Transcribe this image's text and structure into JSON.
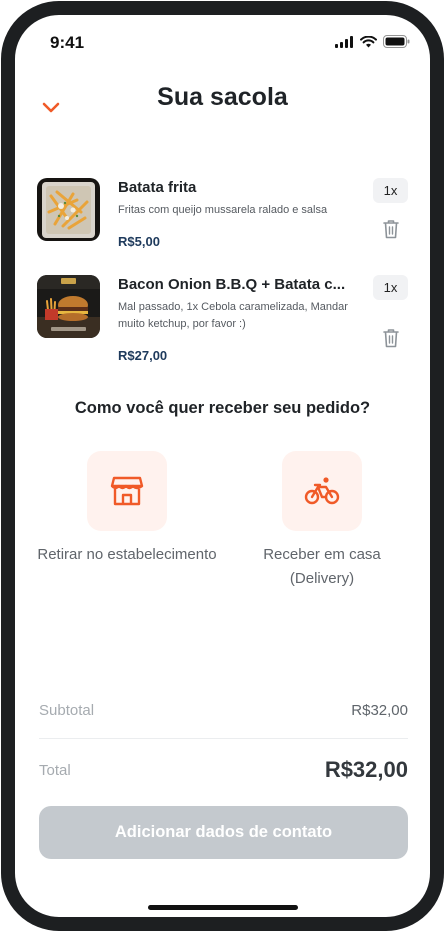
{
  "status": {
    "time": "9:41"
  },
  "header": {
    "title": "Sua sacola",
    "back_icon": "chevron-down-icon"
  },
  "items": [
    {
      "name": "Batata frita",
      "description": "Fritas com queijo mussarela ralado e salsa",
      "price": "R$5,00",
      "quantity": "1x"
    },
    {
      "name": "Bacon Onion B.B.Q + Batata c...",
      "description": "Mal passado, 1x Cebola caramelizada, Mandar muito ketchup, por favor :)",
      "price": "R$27,00",
      "quantity": "1x"
    }
  ],
  "delivery": {
    "question": "Como você quer receber seu pedido?",
    "options": [
      {
        "label": "Retirar no estabelecimento",
        "icon": "store-icon"
      },
      {
        "label": "Receber em casa (Delivery)",
        "icon": "bike-icon"
      }
    ]
  },
  "totals": {
    "subtotal_label": "Subtotal",
    "subtotal_value": "R$32,00",
    "total_label": "Total",
    "total_value": "R$32,00"
  },
  "cta": {
    "label": "Adicionar dados de contato"
  },
  "colors": {
    "accent": "#f05a28",
    "price": "#1e3a5c",
    "cta_disabled": "#c4c9ce",
    "option_bg": "#fff2ee"
  }
}
